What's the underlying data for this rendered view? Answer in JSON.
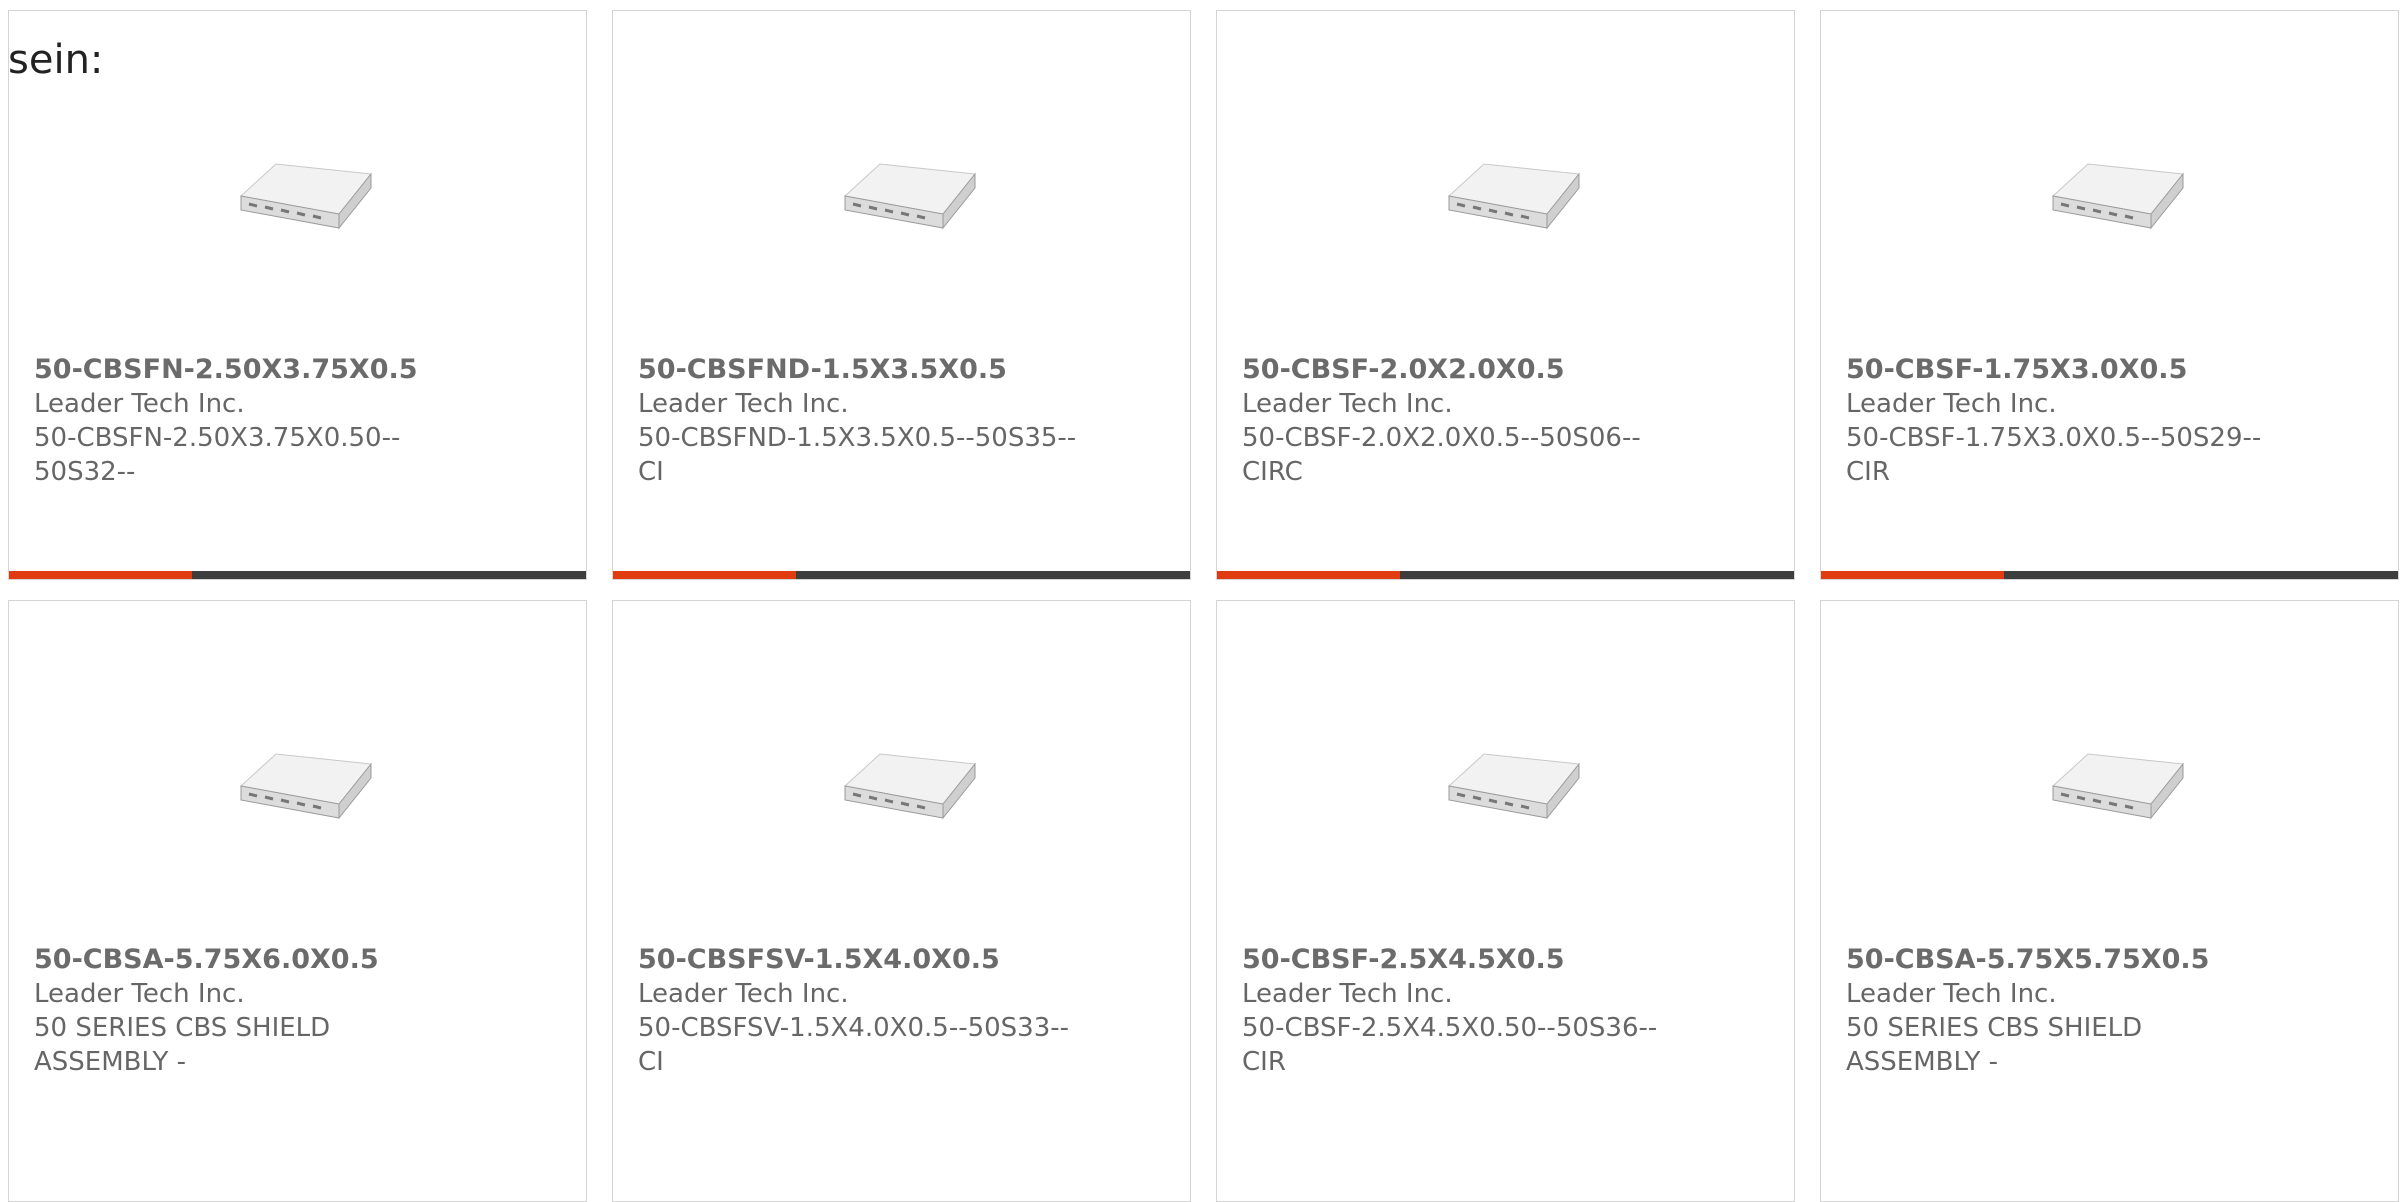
{
  "prefix_text": "sein:",
  "accent_color": "#e03c10",
  "bar_color": "#3d3d3d",
  "products": [
    {
      "part_number": "50-CBSFN-2.50X3.75X0.5",
      "manufacturer": "Leader Tech Inc.",
      "description": "50-CBSFN-2.50X3.75X0.50--\n50S32--",
      "icon": "shield-enclosure-image"
    },
    {
      "part_number": "50-CBSFND-1.5X3.5X0.5",
      "manufacturer": "Leader Tech Inc.",
      "description": "50-CBSFND-1.5X3.5X0.5--50S35--\nCI",
      "icon": "shield-enclosure-image"
    },
    {
      "part_number": "50-CBSF-2.0X2.0X0.5",
      "manufacturer": "Leader Tech Inc.",
      "description": "50-CBSF-2.0X2.0X0.5--50S06--\nCIRC",
      "icon": "shield-enclosure-image"
    },
    {
      "part_number": "50-CBSF-1.75X3.0X0.5",
      "manufacturer": "Leader Tech Inc.",
      "description": "50-CBSF-1.75X3.0X0.5--50S29--\nCIR",
      "icon": "shield-enclosure-image"
    },
    {
      "part_number": "50-CBSA-5.75X6.0X0.5",
      "manufacturer": "Leader Tech Inc.",
      "description": "50 SERIES CBS SHIELD\nASSEMBLY -",
      "icon": "shield-enclosure-image"
    },
    {
      "part_number": "50-CBSFSV-1.5X4.0X0.5",
      "manufacturer": "Leader Tech Inc.",
      "description": "50-CBSFSV-1.5X4.0X0.5--50S33--\nCI",
      "icon": "shield-enclosure-image"
    },
    {
      "part_number": "50-CBSF-2.5X4.5X0.5",
      "manufacturer": "Leader Tech Inc.",
      "description": "50-CBSF-2.5X4.5X0.50--50S36--\nCIR",
      "icon": "shield-enclosure-image"
    },
    {
      "part_number": "50-CBSA-5.75X5.75X0.5",
      "manufacturer": "Leader Tech Inc.",
      "description": "50 SERIES CBS SHIELD\nASSEMBLY -",
      "icon": "shield-enclosure-image"
    }
  ]
}
